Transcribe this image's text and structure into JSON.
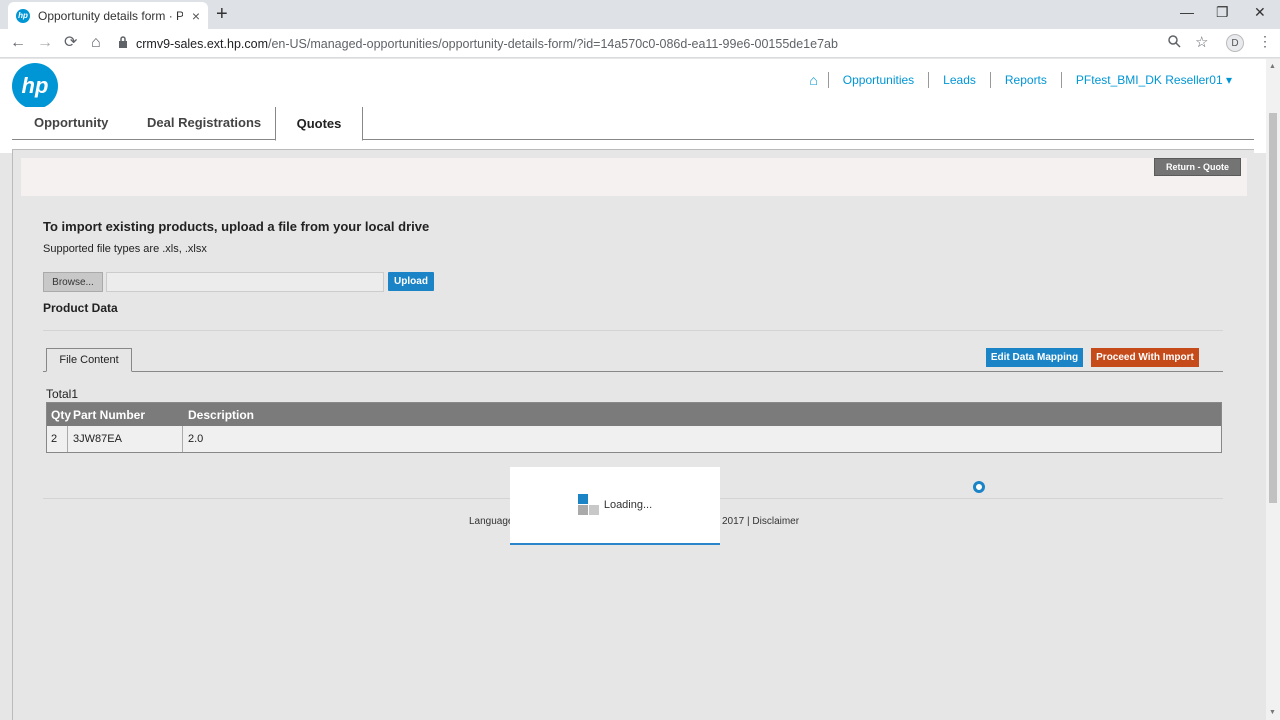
{
  "browser": {
    "tab_title": "Opportunity details form · Partne",
    "tab_close": "×",
    "new_tab": "+",
    "win_min": "—",
    "win_max": "❐",
    "win_close": "✕",
    "back": "←",
    "forward": "→",
    "reload": "⟳",
    "home": "⌂",
    "url_host": "crmv9-sales.ext.hp.com",
    "url_path": "/en-US/managed-opportunities/opportunity-details-form/?id=14a570c0-086d-ea11-99e6-00155de1e7ab",
    "profile_initial": "D",
    "favicon_text": "hp"
  },
  "header": {
    "logo_text": "hp",
    "home_icon": "⌂",
    "nav": [
      "Opportunities",
      "Leads",
      "Reports"
    ],
    "user": "PFtest_BMI_DK Reseller01 ▾"
  },
  "tabs": {
    "items": [
      "Opportunity",
      "Deal Registrations"
    ],
    "active": "Quotes"
  },
  "return_button": "Return - Quote",
  "import": {
    "title": "To import existing products, upload a file from your local drive",
    "subtitle": "Supported file types are .xls, .xlsx",
    "browse_label": "Browse...",
    "file_value": "",
    "upload_label": "Upload"
  },
  "product_data": {
    "title": "Product Data",
    "file_tab": "File Content",
    "edit_mapping": "Edit Data Mapping",
    "proceed_import": "Proceed With Import",
    "total_label": "Total1",
    "columns": [
      "Qty",
      "Part Number",
      "Description"
    ],
    "rows": [
      {
        "qty": "2",
        "part": "3JW87EA",
        "desc": "2.0"
      }
    ]
  },
  "footer": {
    "left": "Language",
    "right": "2017 | Disclaimer"
  },
  "loading_text": "Loading...",
  "colors": {
    "hp_blue": "#0096d6",
    "button_blue": "#1b84c6",
    "proceed_orange": "#c54b1b",
    "table_header": "#7b7b7b"
  }
}
